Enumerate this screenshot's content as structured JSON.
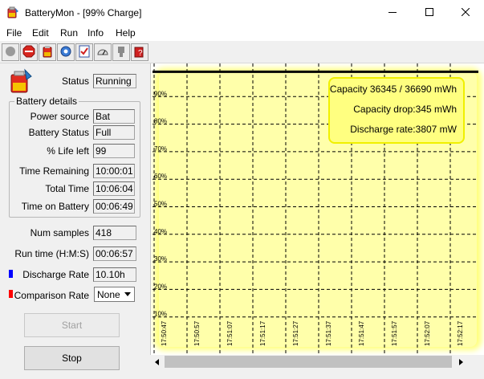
{
  "window": {
    "title": "BatteryMon - [99% Charge]",
    "app_icon": "battery-app-icon"
  },
  "menu": {
    "items": [
      "File",
      "Edit",
      "Run",
      "Info",
      "Help"
    ]
  },
  "toolbar": {
    "buttons": [
      {
        "icon": "record-icon"
      },
      {
        "icon": "stop-sign-icon"
      },
      {
        "icon": "battery-icon"
      },
      {
        "icon": "settings-gear-icon"
      },
      {
        "icon": "checklist-icon"
      },
      {
        "icon": "gauge-icon"
      },
      {
        "icon": "plugin-icon"
      },
      {
        "icon": "help-icon"
      }
    ]
  },
  "status": {
    "label": "Status",
    "value": "Running"
  },
  "battery_details": {
    "title": "Battery details",
    "power_source": {
      "label": "Power source",
      "value": "Bat"
    },
    "battery_status": {
      "label": "Battery Status",
      "value": "Full"
    },
    "life_left": {
      "label": "% Life left",
      "value": "99"
    },
    "time_remaining": {
      "label": "Time Remaining",
      "value": "10:00:01"
    },
    "total_time": {
      "label": "Total Time",
      "value": "10:06:04"
    },
    "time_on_battery": {
      "label": "Time on Battery",
      "value": "00:06:49"
    }
  },
  "stats": {
    "num_samples": {
      "label": "Num samples",
      "value": "418"
    },
    "run_time": {
      "label": "Run time (H:M:S)",
      "value": "00:06:57"
    },
    "discharge_rate": {
      "label": "Discharge Rate",
      "value": "10.10h",
      "color": "#0000ff"
    },
    "comparison_rate": {
      "label": "Comparison Rate",
      "value": "None",
      "color": "#ff0000"
    }
  },
  "buttons": {
    "start": "Start",
    "stop": "Stop"
  },
  "chart_info": {
    "capacity": "Capacity 36345 / 36690 mWh",
    "capacity_drop_label": "Capacity drop:",
    "capacity_drop_value": "345 mWh",
    "discharge_rate_label": "Discharge rate:",
    "discharge_rate_value": "3807 mW"
  },
  "colors": {
    "chart_bg": "#ffffaa",
    "info_box_bg": "#ffff80",
    "grid": "#000000"
  },
  "chart_data": {
    "type": "line",
    "y_ticks": [
      "90%",
      "80%",
      "70%",
      "60%",
      "50%",
      "40%",
      "30%",
      "20%",
      "10%"
    ],
    "x_ticks": [
      "17:50:47",
      "17:50:57",
      "17:51:07",
      "17:51:17",
      "17:51:27",
      "17:51:37",
      "17:51:47",
      "17:51:57",
      "17:52:07",
      "17:52:17"
    ],
    "ylim": [
      0,
      100
    ],
    "grid": true,
    "series": [
      {
        "values": [
          99,
          99,
          99,
          99,
          99,
          99,
          99,
          99,
          99,
          99,
          99
        ],
        "color": "#000000"
      }
    ]
  }
}
